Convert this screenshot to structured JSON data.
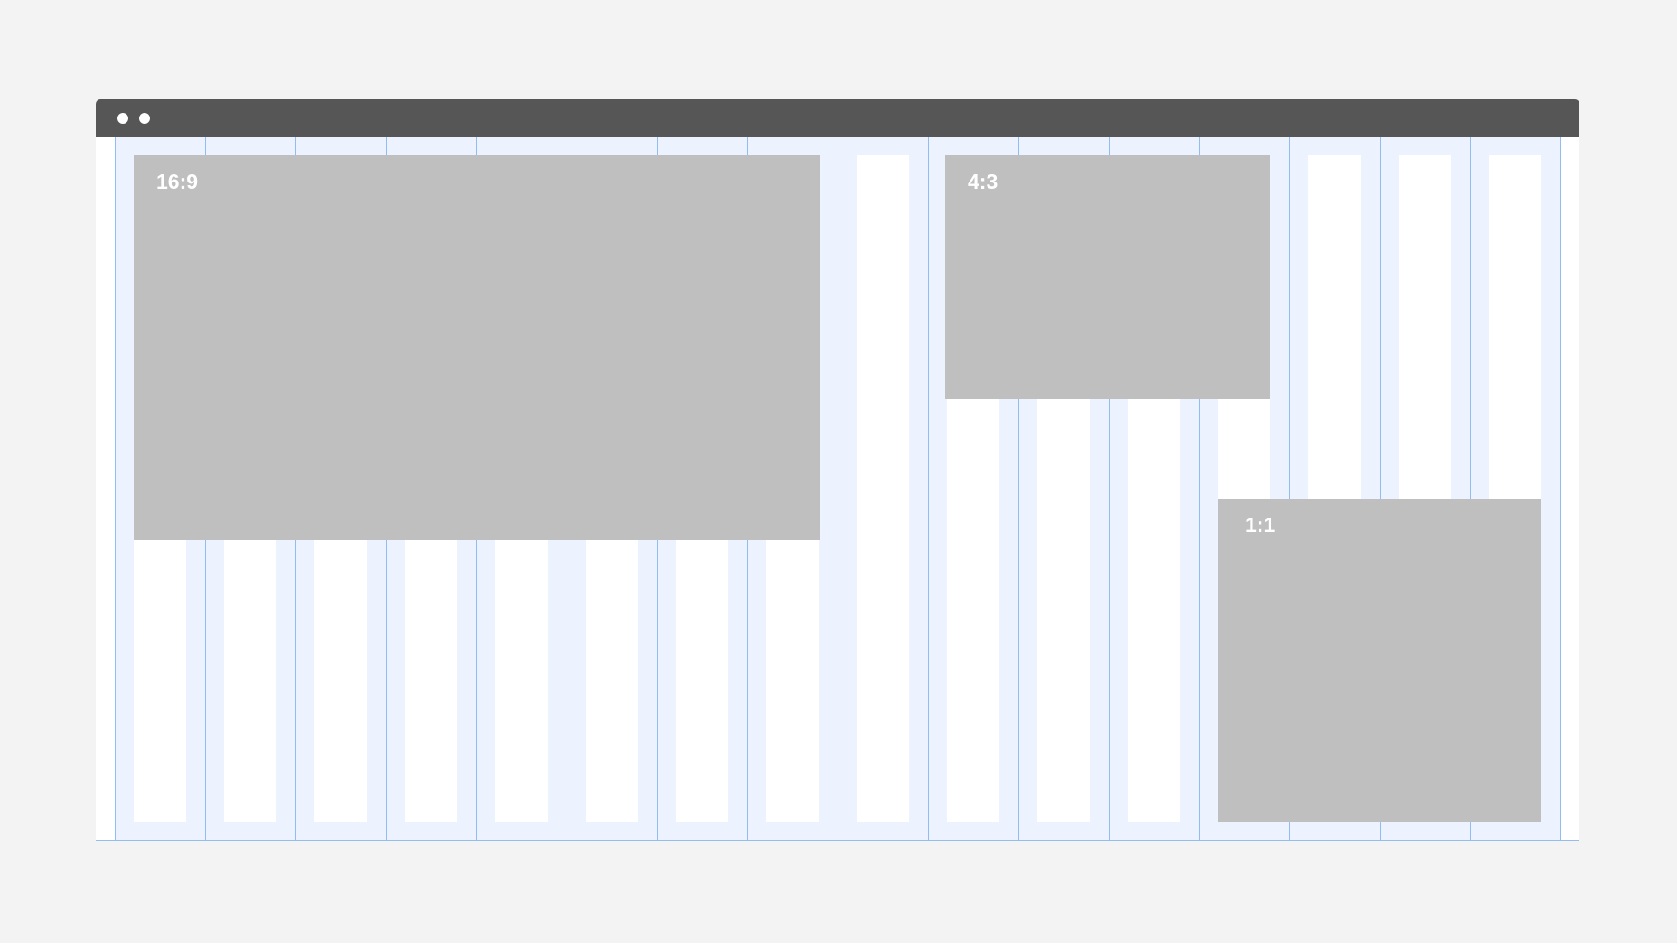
{
  "window": {
    "titlebar_color": "#565656",
    "titlebar_dots": 2,
    "grid": {
      "columns": 16,
      "gutter_color": "#ecf3fe",
      "line_color": "#92bdf0",
      "column_color": "#ffffff"
    }
  },
  "placeholders": [
    {
      "label": "16:9",
      "color": "#bfbfbf"
    },
    {
      "label": "4:3",
      "color": "#bfbfbf"
    },
    {
      "label": "1:1",
      "color": "#bfbfbf"
    }
  ]
}
